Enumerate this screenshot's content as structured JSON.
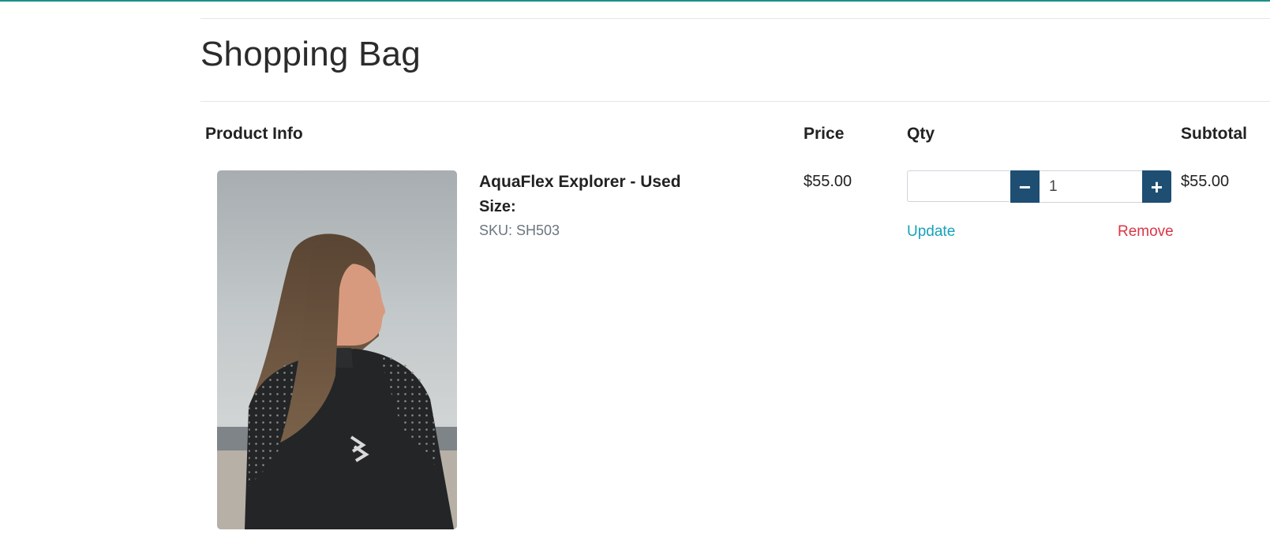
{
  "page": {
    "title": "Shopping Bag",
    "accent_color": "#1f8f8a"
  },
  "table": {
    "headers": {
      "product_info": "Product Info",
      "price": "Price",
      "qty": "Qty",
      "subtotal": "Subtotal"
    }
  },
  "cart_item": {
    "name": "AquaFlex Explorer - Used",
    "size_label": "Size:",
    "sku": "SKU: SH503",
    "price": "$55.00",
    "quantity": "1",
    "subtotal": "$55.00",
    "image_icon": "wetsuit-product-photo",
    "actions": {
      "decrement_symbol": "−",
      "increment_symbol": "+",
      "update_label": "Update",
      "remove_label": "Remove"
    }
  },
  "colors": {
    "qty_button": "#1f4e73",
    "update_link": "#17a2b8",
    "remove_link": "#dc3545"
  }
}
